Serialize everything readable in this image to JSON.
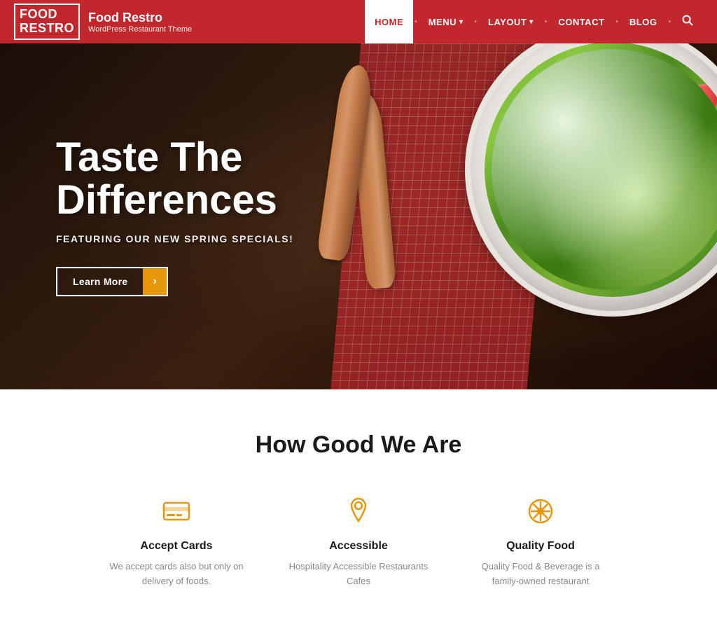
{
  "header": {
    "logo_line1": "Food",
    "logo_line2": "Restro",
    "site_name": "Food Restro",
    "tagline": "WordPress Restaurant Theme",
    "nav_items": [
      {
        "label": "HOME",
        "active": true,
        "has_dropdown": false
      },
      {
        "label": "MENU",
        "active": false,
        "has_dropdown": true
      },
      {
        "label": "LAYOUT",
        "active": false,
        "has_dropdown": true
      },
      {
        "label": "CONTACT",
        "active": false,
        "has_dropdown": false
      },
      {
        "label": "BLOG",
        "active": false,
        "has_dropdown": false
      }
    ]
  },
  "hero": {
    "title_line1": "Taste The",
    "title_line2": "Differences",
    "subtitle": "FEATURING OUR NEW SPRING SPECIALS!",
    "btn_label": "Learn More",
    "btn_arrow": "›"
  },
  "features": {
    "section_title": "How Good We Are",
    "items": [
      {
        "icon": "card",
        "name": "Accept Cards",
        "desc": "We accept cards also but only on delivery of foods."
      },
      {
        "icon": "pin",
        "name": "Accessible",
        "desc": "Hospitality Accessible Restaurants Cafes"
      },
      {
        "icon": "snowflake",
        "name": "Quality Food",
        "desc": "Quality Food & Beverage is a family-owned restaurant"
      }
    ]
  }
}
